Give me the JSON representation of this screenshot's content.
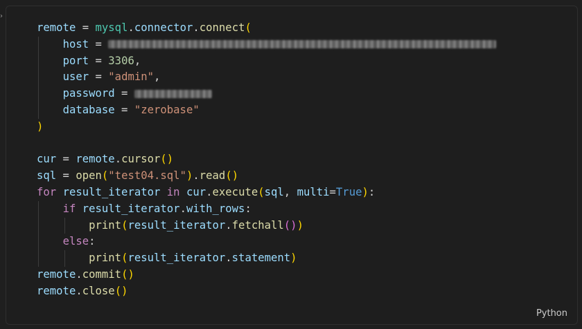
{
  "code_block": {
    "language_label": "Python",
    "lines": [
      {
        "tokens": [
          [
            "remote",
            "var"
          ],
          [
            " = ",
            "op"
          ],
          [
            "mysql",
            "cls"
          ],
          [
            ".",
            "op"
          ],
          [
            "connector",
            "var"
          ],
          [
            ".",
            "op"
          ],
          [
            "connect",
            "fn"
          ],
          [
            "(",
            "b1"
          ]
        ]
      },
      {
        "indent": 1,
        "tokens": [
          [
            "host",
            "var"
          ],
          [
            " = ",
            "op"
          ]
        ],
        "redacted": "host-value"
      },
      {
        "indent": 1,
        "tokens": [
          [
            "port",
            "var"
          ],
          [
            " = ",
            "op"
          ],
          [
            "3306",
            "num"
          ],
          [
            ",",
            "op"
          ]
        ]
      },
      {
        "indent": 1,
        "tokens": [
          [
            "user",
            "var"
          ],
          [
            " = ",
            "op"
          ],
          [
            "\"admin\"",
            "str"
          ],
          [
            ",",
            "op"
          ]
        ]
      },
      {
        "indent": 1,
        "tokens": [
          [
            "password",
            "var"
          ],
          [
            " = ",
            "op"
          ]
        ],
        "redacted": "password-value"
      },
      {
        "indent": 1,
        "tokens": [
          [
            "database",
            "var"
          ],
          [
            " = ",
            "op"
          ],
          [
            "\"zerobase\"",
            "str"
          ]
        ]
      },
      {
        "tokens": [
          [
            ")",
            "b1"
          ]
        ]
      },
      {
        "tokens": []
      },
      {
        "tokens": [
          [
            "cur",
            "var"
          ],
          [
            " = ",
            "op"
          ],
          [
            "remote",
            "var"
          ],
          [
            ".",
            "op"
          ],
          [
            "cursor",
            "fn"
          ],
          [
            "()",
            "b1"
          ]
        ]
      },
      {
        "tokens": [
          [
            "sql",
            "var"
          ],
          [
            " = ",
            "op"
          ],
          [
            "open",
            "fn"
          ],
          [
            "(",
            "b1"
          ],
          [
            "\"test04.sql\"",
            "str"
          ],
          [
            ")",
            "b1"
          ],
          [
            ".",
            "op"
          ],
          [
            "read",
            "fn"
          ],
          [
            "()",
            "b1"
          ]
        ]
      },
      {
        "tokens": [
          [
            "for",
            "kw"
          ],
          [
            " ",
            "op"
          ],
          [
            "result_iterator",
            "var"
          ],
          [
            " ",
            "op"
          ],
          [
            "in",
            "kw"
          ],
          [
            " ",
            "op"
          ],
          [
            "cur",
            "var"
          ],
          [
            ".",
            "op"
          ],
          [
            "execute",
            "fn"
          ],
          [
            "(",
            "b1"
          ],
          [
            "sql",
            "var"
          ],
          [
            ", ",
            "op"
          ],
          [
            "multi",
            "var"
          ],
          [
            "=",
            "op"
          ],
          [
            "True",
            "const"
          ],
          [
            ")",
            "b1"
          ],
          [
            ":",
            "op"
          ]
        ]
      },
      {
        "indent": 1,
        "tokens": [
          [
            "if",
            "kw"
          ],
          [
            " ",
            "op"
          ],
          [
            "result_iterator",
            "var"
          ],
          [
            ".",
            "op"
          ],
          [
            "with_rows",
            "var"
          ],
          [
            ":",
            "op"
          ]
        ]
      },
      {
        "indent": 2,
        "tokens": [
          [
            "print",
            "fn"
          ],
          [
            "(",
            "b1"
          ],
          [
            "result_iterator",
            "var"
          ],
          [
            ".",
            "op"
          ],
          [
            "fetchall",
            "fn"
          ],
          [
            "()",
            "b2"
          ],
          [
            ")",
            "b1"
          ]
        ]
      },
      {
        "indent": 1,
        "tokens": [
          [
            "else",
            "kw"
          ],
          [
            ":",
            "op"
          ]
        ]
      },
      {
        "indent": 2,
        "tokens": [
          [
            "print",
            "fn"
          ],
          [
            "(",
            "b1"
          ],
          [
            "result_iterator",
            "var"
          ],
          [
            ".",
            "op"
          ],
          [
            "statement",
            "var"
          ],
          [
            ")",
            "b1"
          ]
        ]
      },
      {
        "tokens": [
          [
            "remote",
            "var"
          ],
          [
            ".",
            "op"
          ],
          [
            "commit",
            "fn"
          ],
          [
            "()",
            "b1"
          ]
        ]
      },
      {
        "tokens": [
          [
            "remote",
            "var"
          ],
          [
            ".",
            "op"
          ],
          [
            "close",
            "fn"
          ],
          [
            "()",
            "b1"
          ]
        ]
      }
    ]
  }
}
